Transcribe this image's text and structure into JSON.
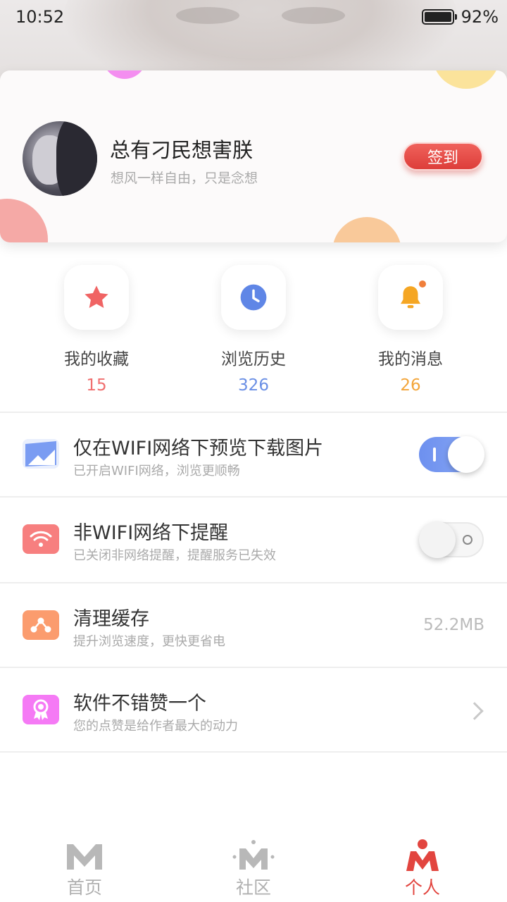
{
  "status_bar": {
    "time": "10:52",
    "battery": "92%"
  },
  "profile": {
    "name": "总有刁民想害朕",
    "motto": "想风一样自由，只是念想",
    "checkin_label": "签到"
  },
  "shortcuts": [
    {
      "label": "我的收藏",
      "count": "15",
      "color": "#f06e6e",
      "icon": "star-icon"
    },
    {
      "label": "浏览历史",
      "count": "326",
      "color": "#6a8fe5",
      "icon": "clock-icon"
    },
    {
      "label": "我的消息",
      "count": "26",
      "color": "#f3a53a",
      "icon": "bell-icon"
    }
  ],
  "settings": {
    "wifi_preview": {
      "title": "仅在WIFI网络下预览下载图片",
      "subtitle": "已开启WIFI网络，浏览更顺畅",
      "enabled": true
    },
    "non_wifi_alert": {
      "title": "非WIFI网络下提醒",
      "subtitle": "已关闭非网络提醒，提醒服务已失效",
      "enabled": false
    },
    "clear_cache": {
      "title": "清理缓存",
      "subtitle": "提升浏览速度，更快更省电",
      "size": "52.2MB"
    },
    "like_app": {
      "title": "软件不错赞一个",
      "subtitle": "您的点赞是给作者最大的动力"
    }
  },
  "bottom_nav": [
    {
      "label": "首页",
      "active": false
    },
    {
      "label": "社区",
      "active": false
    },
    {
      "label": "个人",
      "active": true
    }
  ],
  "colors": {
    "accent": "#e2453f",
    "toggle_on": "#7498ee",
    "inactive_nav": "#b5b5b5"
  }
}
